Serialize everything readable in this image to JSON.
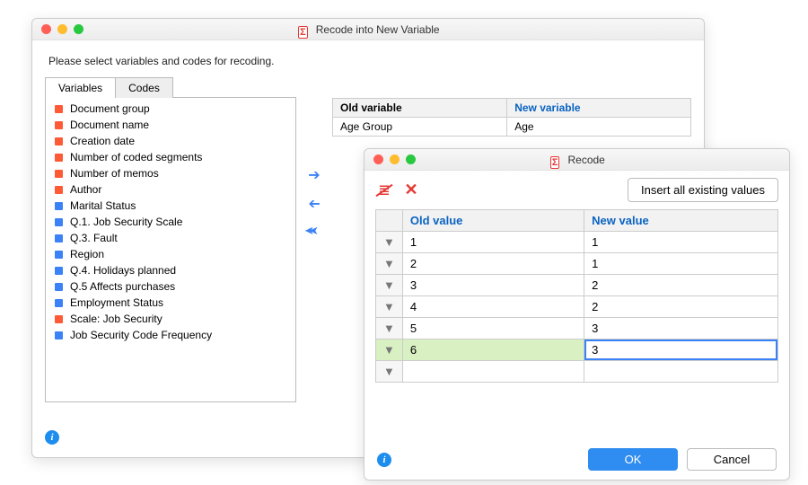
{
  "main": {
    "title": "Recode into New Variable",
    "instruction": "Please select variables and codes for recoding.",
    "tabs": {
      "variables": "Variables",
      "codes": "Codes"
    },
    "varlist": [
      {
        "c": "red",
        "t": "Document group"
      },
      {
        "c": "red",
        "t": "Document name"
      },
      {
        "c": "red",
        "t": "Creation date"
      },
      {
        "c": "red",
        "t": "Number of coded segments"
      },
      {
        "c": "red",
        "t": "Number of memos"
      },
      {
        "c": "red",
        "t": "Author"
      },
      {
        "c": "blue",
        "t": "Marital Status"
      },
      {
        "c": "blue",
        "t": "Q.1. Job Security Scale"
      },
      {
        "c": "blue",
        "t": "Q.3. Fault"
      },
      {
        "c": "blue",
        "t": "Region"
      },
      {
        "c": "blue",
        "t": "Q.4. Holidays planned"
      },
      {
        "c": "blue",
        "t": "Q.5 Affects purchases"
      },
      {
        "c": "blue",
        "t": "Employment Status"
      },
      {
        "c": "red",
        "t": "Scale: Job Security"
      },
      {
        "c": "blue",
        "t": "Job Security Code Frequency"
      }
    ],
    "table": {
      "old_h": "Old variable",
      "new_h": "New variable",
      "row": {
        "old": "Age Group",
        "new": "Age"
      }
    }
  },
  "recode": {
    "title": "Recode",
    "insert_btn": "Insert all existing values",
    "headers": {
      "old": "Old value",
      "new": "New value"
    },
    "rows": [
      {
        "old": "1",
        "new": "1"
      },
      {
        "old": "2",
        "new": "1"
      },
      {
        "old": "3",
        "new": "2"
      },
      {
        "old": "4",
        "new": "2"
      },
      {
        "old": "5",
        "new": "3"
      },
      {
        "old": "6",
        "new": "3"
      }
    ],
    "ok": "OK",
    "cancel": "Cancel"
  }
}
